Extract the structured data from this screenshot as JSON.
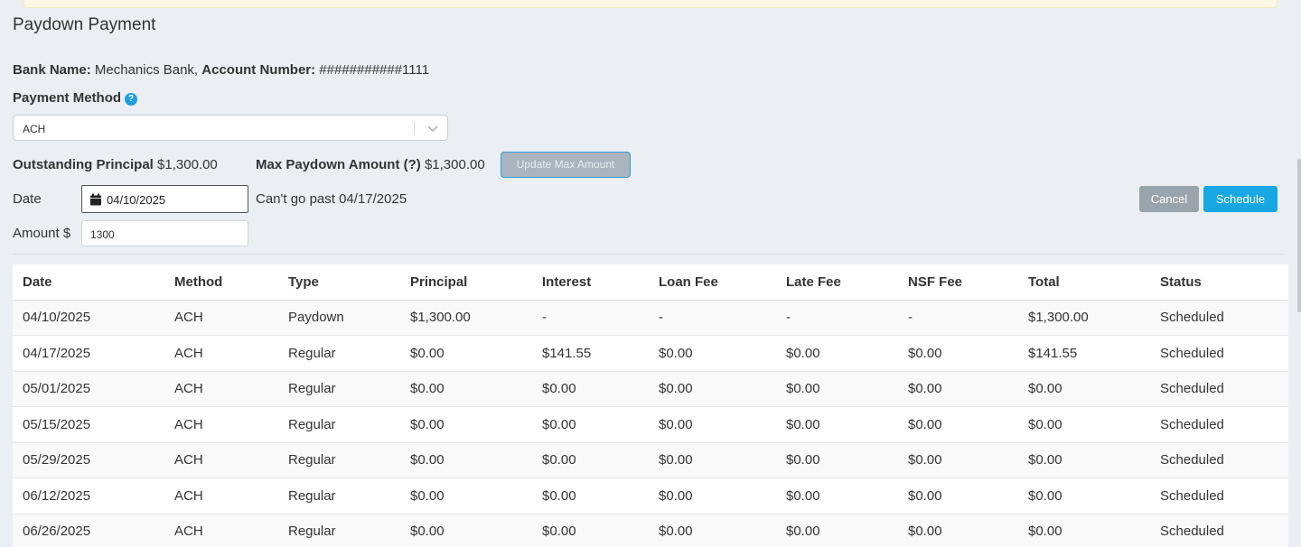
{
  "page_title": "Paydown Payment",
  "bank": {
    "bank_name_label": "Bank Name:",
    "bank_name": "Mechanics Bank,",
    "account_label": "Account Number:",
    "account_number": "###########1111"
  },
  "payment_method": {
    "label": "Payment Method",
    "help_icon": "?",
    "selected": "ACH"
  },
  "outstanding": {
    "label": "Outstanding Principal",
    "value": "$1,300.00"
  },
  "max_paydown": {
    "label": "Max Paydown Amount (?)",
    "value": "$1,300.00",
    "update_button": "Update Max Amount"
  },
  "date_field": {
    "label": "Date",
    "value": "04/10/2025",
    "hint": "Can't go past 04/17/2025"
  },
  "amount_field": {
    "label": "Amount $",
    "value": "1300"
  },
  "actions": {
    "cancel": "Cancel",
    "schedule": "Schedule"
  },
  "table": {
    "headers": [
      "Date",
      "Method",
      "Type",
      "Principal",
      "Interest",
      "Loan Fee",
      "Late Fee",
      "NSF Fee",
      "Total",
      "Status"
    ],
    "rows": [
      [
        "04/10/2025",
        "ACH",
        "Paydown",
        "$1,300.00",
        "-",
        "-",
        "-",
        "-",
        "$1,300.00",
        "Scheduled"
      ],
      [
        "04/17/2025",
        "ACH",
        "Regular",
        "$0.00",
        "$141.55",
        "$0.00",
        "$0.00",
        "$0.00",
        "$141.55",
        "Scheduled"
      ],
      [
        "05/01/2025",
        "ACH",
        "Regular",
        "$0.00",
        "$0.00",
        "$0.00",
        "$0.00",
        "$0.00",
        "$0.00",
        "Scheduled"
      ],
      [
        "05/15/2025",
        "ACH",
        "Regular",
        "$0.00",
        "$0.00",
        "$0.00",
        "$0.00",
        "$0.00",
        "$0.00",
        "Scheduled"
      ],
      [
        "05/29/2025",
        "ACH",
        "Regular",
        "$0.00",
        "$0.00",
        "$0.00",
        "$0.00",
        "$0.00",
        "$0.00",
        "Scheduled"
      ],
      [
        "06/12/2025",
        "ACH",
        "Regular",
        "$0.00",
        "$0.00",
        "$0.00",
        "$0.00",
        "$0.00",
        "$0.00",
        "Scheduled"
      ],
      [
        "06/26/2025",
        "ACH",
        "Regular",
        "$0.00",
        "$0.00",
        "$0.00",
        "$0.00",
        "$0.00",
        "$0.00",
        "Scheduled"
      ]
    ]
  },
  "colors": {
    "accent": "#17a7e3",
    "cancel_gray": "#9aa4ad",
    "background": "#ebeff3"
  }
}
